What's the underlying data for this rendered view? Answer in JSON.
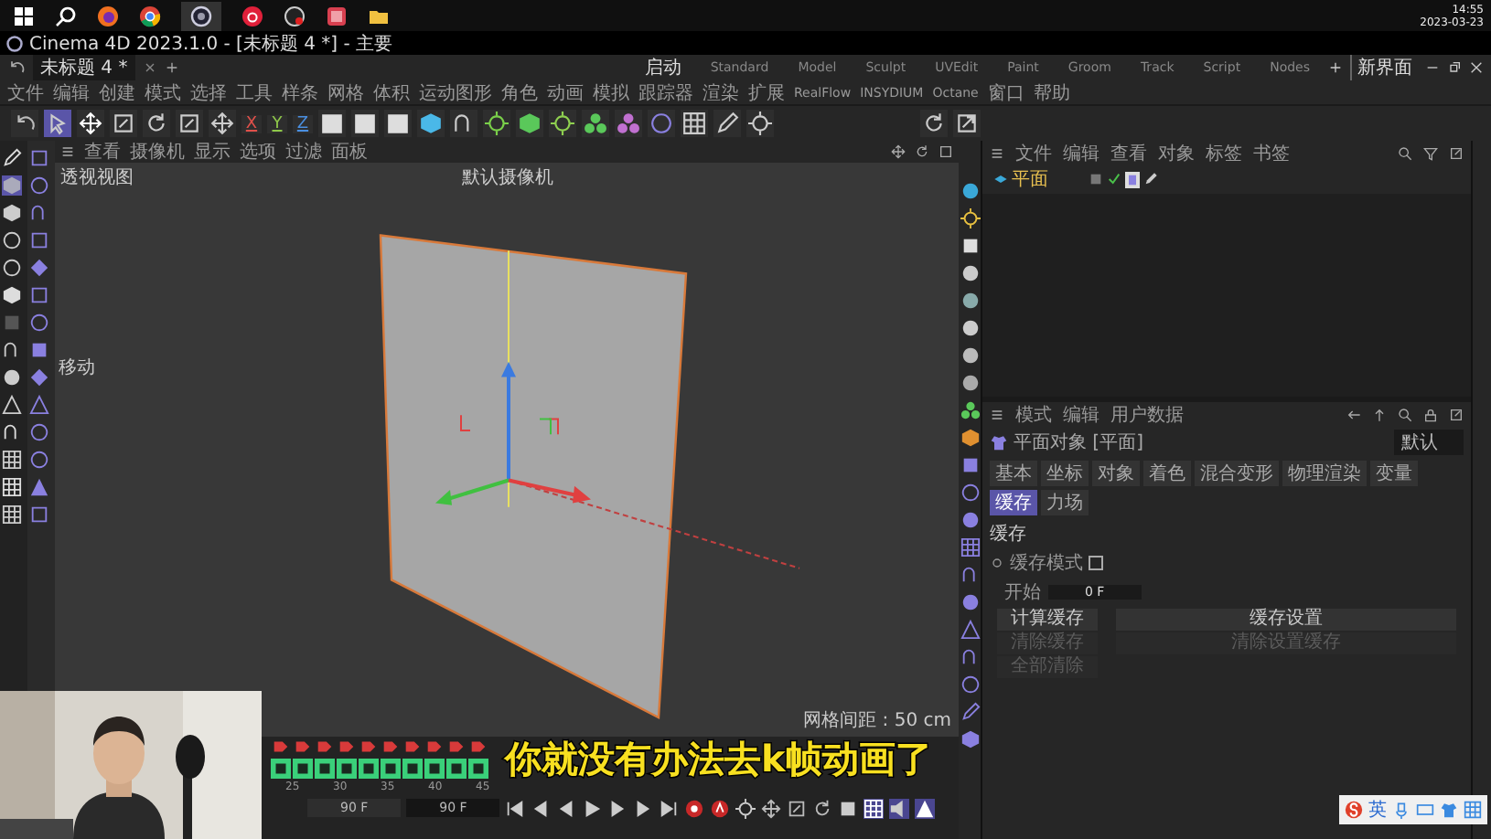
{
  "taskbar": {
    "time": "14:55",
    "date": "2023-03-23"
  },
  "window": {
    "title": "Cinema 4D 2023.1.0 - [未标题 4 *] - 主要"
  },
  "document_tab": {
    "label": "未标题 4 *"
  },
  "layouts": [
    {
      "label": "启动",
      "selected": true
    },
    {
      "label": "Standard",
      "selected": false
    },
    {
      "label": "Model",
      "selected": false
    },
    {
      "label": "Sculpt",
      "selected": false
    },
    {
      "label": "UVEdit",
      "selected": false
    },
    {
      "label": "Paint",
      "selected": false
    },
    {
      "label": "Groom",
      "selected": false
    },
    {
      "label": "Track",
      "selected": false
    },
    {
      "label": "Script",
      "selected": false
    },
    {
      "label": "Nodes",
      "selected": false
    }
  ],
  "new_layout": "新界面",
  "menu": [
    "文件",
    "编辑",
    "创建",
    "模式",
    "选择",
    "工具",
    "样条",
    "网格",
    "体积",
    "运动图形",
    "角色",
    "动画",
    "模拟",
    "跟踪器",
    "渲染",
    "扩展",
    "RealFlow",
    "INSYDIUM",
    "Octane",
    "窗口",
    "帮助"
  ],
  "axis_locks": [
    {
      "label": "X",
      "color": "#e0504a"
    },
    {
      "label": "Y",
      "color": "#8fc84a"
    },
    {
      "label": "Z",
      "color": "#4a8fe0"
    }
  ],
  "viewport": {
    "menu": [
      "查看",
      "摄像机",
      "显示",
      "选项",
      "过滤",
      "面板"
    ],
    "view_name": "透视视图",
    "camera": "默认摄像机",
    "tooltip": "移动",
    "grid_spacing": "网格间距 : 50 cm"
  },
  "objects_panel": {
    "menu": [
      "文件",
      "编辑",
      "查看",
      "对象",
      "标签",
      "书签"
    ],
    "objects": [
      {
        "name": "平面"
      }
    ]
  },
  "attributes": {
    "menu": [
      "模式",
      "编辑",
      "用户数据"
    ],
    "object": "平面对象 [平面]",
    "preset": "默认",
    "tabs": [
      {
        "label": "基本",
        "selected": false
      },
      {
        "label": "坐标",
        "selected": false
      },
      {
        "label": "对象",
        "selected": false
      },
      {
        "label": "着色",
        "selected": false
      },
      {
        "label": "混合变形",
        "selected": false
      },
      {
        "label": "物理渲染",
        "selected": false
      },
      {
        "label": "变量",
        "selected": false
      },
      {
        "label": "缓存",
        "selected": true
      },
      {
        "label": "力场",
        "selected": false
      }
    ],
    "section": "缓存",
    "cache_mode": {
      "label": "缓存模式",
      "checked": false
    },
    "start": {
      "label": "开始",
      "value": "0 F"
    },
    "left_buttons": [
      {
        "label": "计算缓存",
        "disabled": false
      },
      {
        "label": "清除缓存",
        "disabled": true
      },
      {
        "label": "全部清除",
        "disabled": true
      }
    ],
    "right_buttons": [
      {
        "label": "缓存设置",
        "disabled": false
      },
      {
        "label": "清除设置缓存",
        "disabled": true
      }
    ]
  },
  "timeline": {
    "ticks": [
      "25",
      "30",
      "35",
      "40",
      "45"
    ],
    "end_frame": "90 F",
    "preview_end": "90 F"
  },
  "subtitle": "你就没有办法去k帧动画了",
  "ime": {
    "label": "英"
  }
}
